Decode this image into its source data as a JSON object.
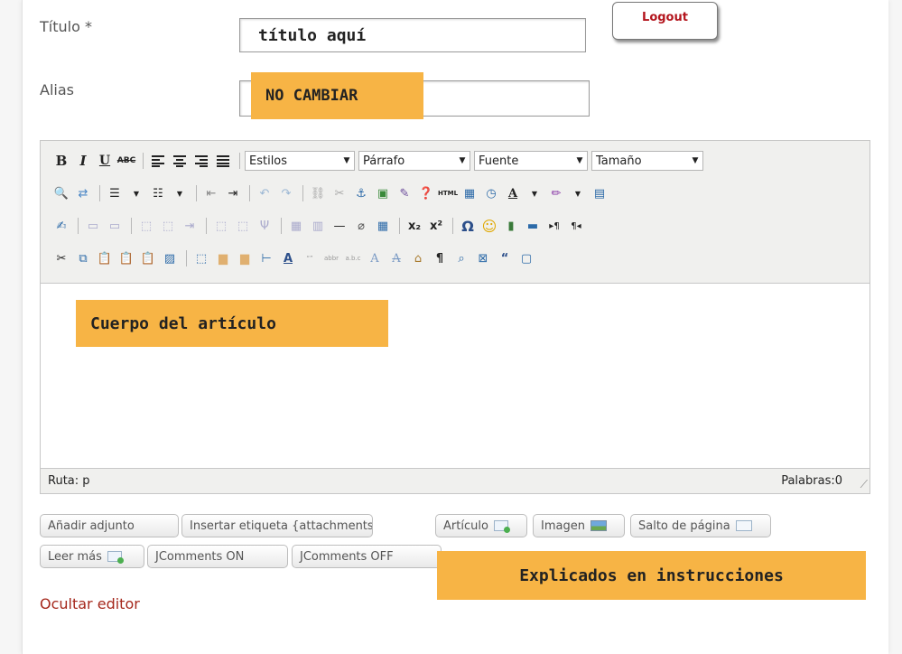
{
  "form": {
    "title_label": "Título *",
    "title_value": "título aquí",
    "alias_label": "Alias",
    "alias_value": "",
    "logout_label": "Logout"
  },
  "callouts": {
    "alias": "NO CAMBIAR",
    "body": "Cuerpo del artículo",
    "buttons": "Explicados en instrucciones"
  },
  "toolbar": {
    "row1_buttons": [
      "B",
      "I",
      "U",
      "ABC"
    ],
    "selects": [
      "Estilos",
      "Párrafo",
      "Fuente",
      "Tamaño"
    ],
    "row2_html": "HTML"
  },
  "editor": {
    "path_label": "Ruta: p",
    "word_count": "Palabras:0"
  },
  "buttons": {
    "attach": "Añadir adjunto",
    "insert_tag": "Insertar etiqueta {attachments}",
    "article": "Artículo",
    "image": "Imagen",
    "page_break": "Salto de página",
    "read_more": "Leer más",
    "jcomments_on": "JComments ON",
    "jcomments_off": "JComments OFF"
  },
  "hide_editor": "Ocultar editor",
  "colors": {
    "callout": "#f7b445",
    "logout_text": "#b3141c",
    "link_red": "#a5281c"
  }
}
